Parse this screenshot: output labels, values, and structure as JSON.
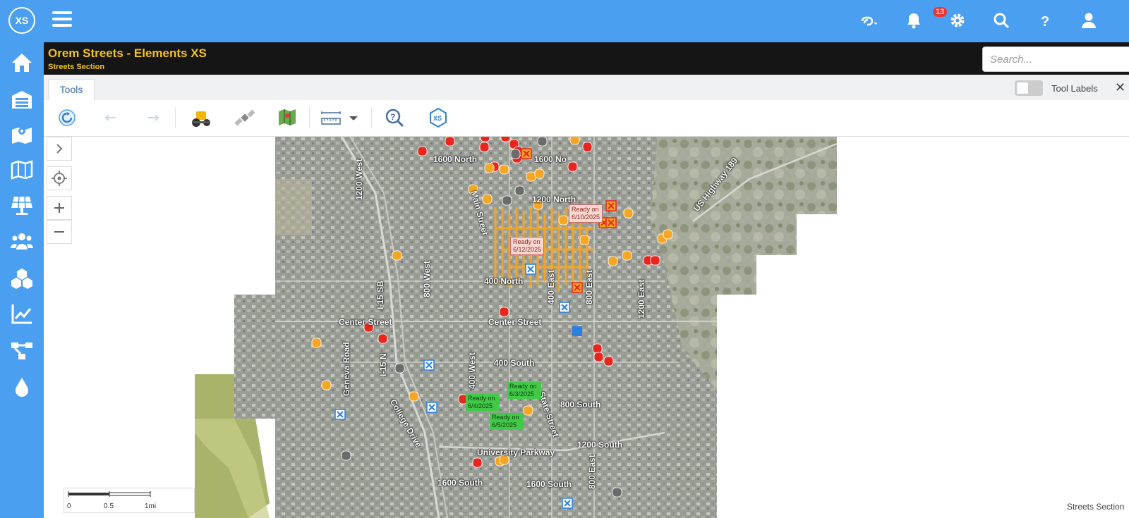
{
  "header": {
    "logo": "XS",
    "notifications_count": "13"
  },
  "titlebar": {
    "title": "Orem Streets - Elements XS",
    "subtitle": "Streets Section",
    "search_placeholder": "Search..."
  },
  "toolbar": {
    "tab_label": "Tools",
    "tool_labels_toggle": "Tool Labels",
    "close": "✕"
  },
  "map": {
    "roads": [
      {
        "name": "1600 North"
      },
      {
        "name": "1600 No"
      },
      {
        "name": "1200 West"
      },
      {
        "name": "Main Street"
      },
      {
        "name": "1200 North"
      },
      {
        "name": "US Highway 189"
      },
      {
        "name": "I-15 SB"
      },
      {
        "name": "800 West"
      },
      {
        "name": "400 North"
      },
      {
        "name": "400 East"
      },
      {
        "name": "800 East"
      },
      {
        "name": "1200 East"
      },
      {
        "name": "Center Street"
      },
      {
        "name": "Center Street"
      },
      {
        "name": "Geneva Road"
      },
      {
        "name": "I-15 N"
      },
      {
        "name": "400 West"
      },
      {
        "name": "400 South"
      },
      {
        "name": "800 South"
      },
      {
        "name": "State Street"
      },
      {
        "name": "College Drive"
      },
      {
        "name": "University Parkway"
      },
      {
        "name": "1200 South"
      },
      {
        "name": "1600 South"
      },
      {
        "name": "1600 South"
      },
      {
        "name": "800 East"
      }
    ],
    "ready_labels": [
      {
        "text": "Ready on 6/10/2025",
        "status": "red"
      },
      {
        "text": "Ready on 6/12/2025",
        "status": "red"
      },
      {
        "text": "Ready on 6/3/2025",
        "status": "green"
      },
      {
        "text": "Ready on 6/4/2025",
        "status": "green"
      },
      {
        "text": "Ready on 6/5/2025",
        "status": "green"
      }
    ],
    "scale": {
      "s0": "0",
      "s1": "0.5",
      "s2": "1mi"
    },
    "footer": "Streets Section"
  },
  "colors": {
    "brand_blue": "#4a9ff0",
    "title_yellow": "#f5c518",
    "marker_red": "#e8261e",
    "marker_orange": "#f5a623",
    "marker_gray": "#6b6b6b",
    "marker_blue": "#2a7fe0"
  },
  "icons": {
    "sidebar": [
      "home-icon",
      "warehouse-icon",
      "map-marker-icon",
      "map-icon",
      "solar-panel-icon",
      "users-icon",
      "cubes-icon",
      "chart-line-icon",
      "network-icon",
      "water-drop-icon"
    ],
    "topbar": [
      "link-icon",
      "bell-icon",
      "gear-icon",
      "search-icon",
      "help-icon",
      "user-icon"
    ],
    "toolbar": [
      "refresh-icon",
      "undo-icon",
      "redo-icon",
      "roller-icon",
      "satellite-icon",
      "map-book-icon",
      "measure-icon",
      "zoom-question-icon",
      "xs-icon"
    ]
  }
}
